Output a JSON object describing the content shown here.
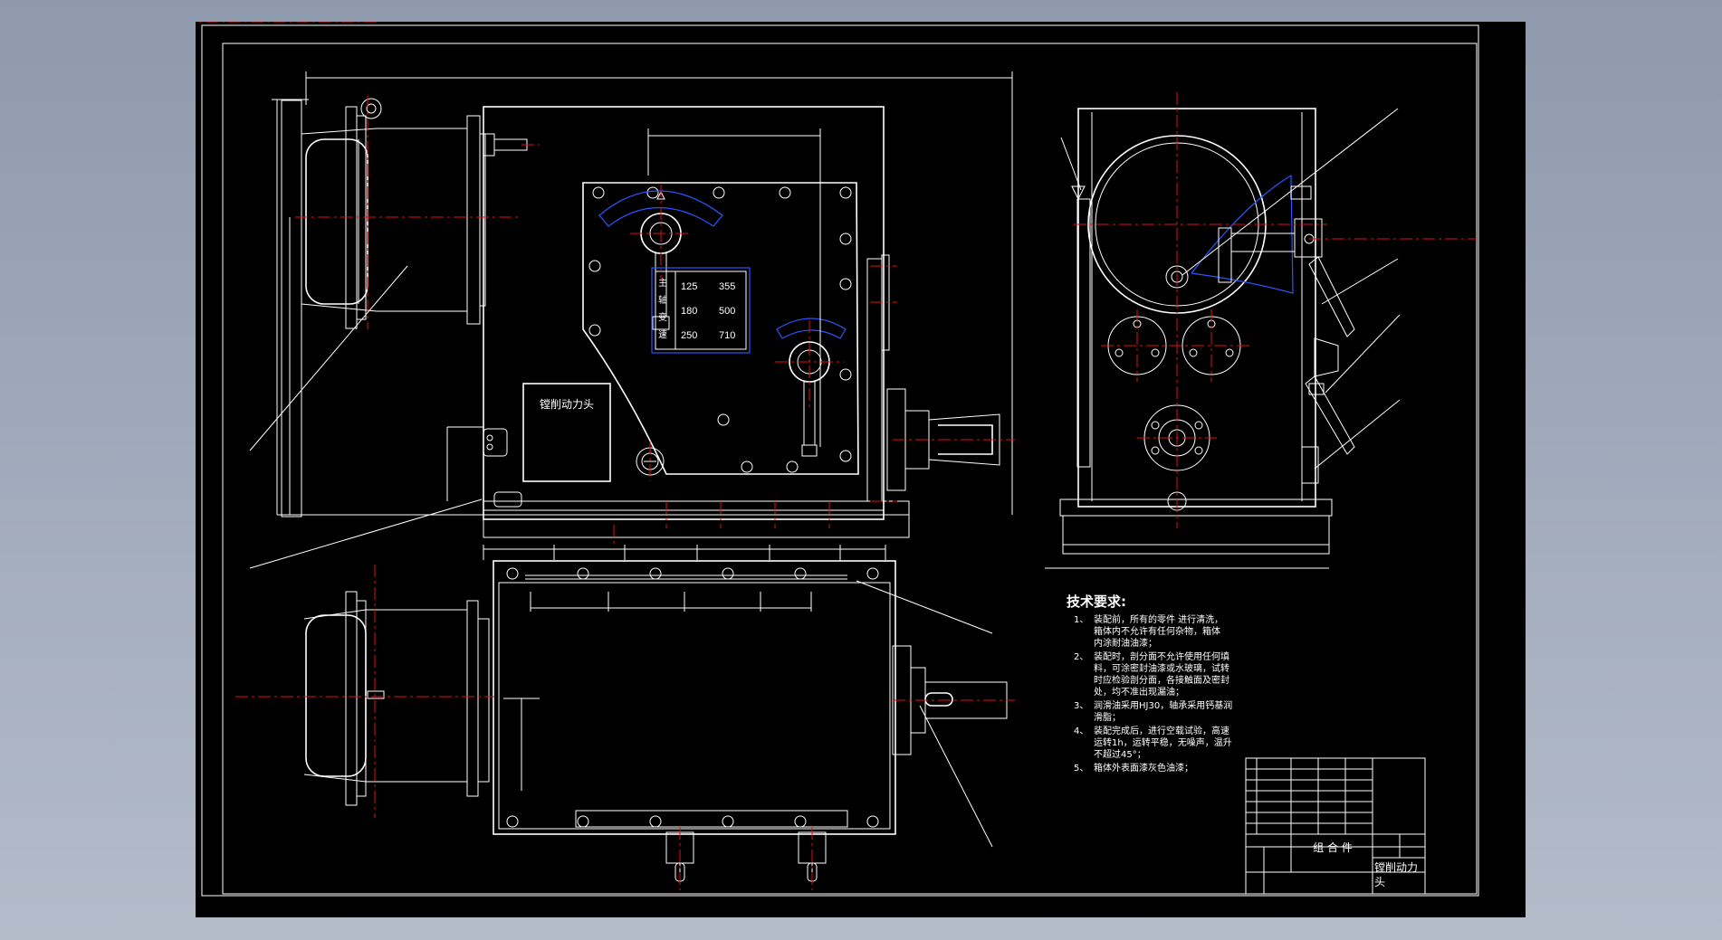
{
  "colors": {
    "background": "#8e99ad",
    "canvas": "#000000",
    "line": "#ffffff",
    "centerline": "#e01010",
    "highlight": "#2b55ff"
  },
  "speed_plate": {
    "row_labels": [
      "主",
      "轴",
      "变",
      "速"
    ],
    "speeds_left": [
      "125",
      "180",
      "250"
    ],
    "speeds_right": [
      "355",
      "500",
      "710"
    ]
  },
  "name_plate": {
    "title": "镗削动力头"
  },
  "tech_requirements": {
    "title": "技术要求:",
    "items": [
      {
        "num": "1、",
        "lines": [
          "装配前，所有的零件  进行清洗，",
          "箱体内不允许有任何杂物，箱体",
          "内涂耐油油漆；"
        ]
      },
      {
        "num": "2、",
        "lines": [
          "装配时，剖分面不允许使用任何填",
          "料，可涂密封油漆或水玻璃，试转",
          "时应检验剖分面，各接触面及密封",
          "处，均不准出现漏油；"
        ]
      },
      {
        "num": "3、",
        "lines": [
          "润滑油采用HJ30，轴承采用钙基润",
          "滑脂；"
        ]
      },
      {
        "num": "4、",
        "lines": [
          "装配完成后，进行空载试验，高速",
          "运转1h，运转平稳，无噪声，温升",
          "不超过45°；"
        ]
      },
      {
        "num": "5、",
        "lines": [
          "箱体外表面漆灰色油漆；"
        ]
      }
    ]
  },
  "title_block": {
    "assembly_label": "组 合 件",
    "name": "镗削动力",
    "name_cont": "头"
  }
}
